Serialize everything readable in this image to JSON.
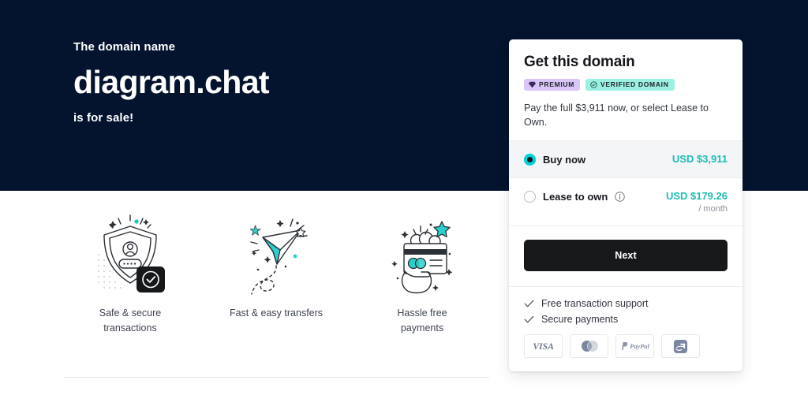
{
  "hero": {
    "kicker": "The domain name",
    "domain": "diagram.chat",
    "subtitle": "is for sale!",
    "background_color": "#05142e"
  },
  "features": [
    {
      "icon": "shield-lock-icon",
      "caption": "Safe & secure transactions"
    },
    {
      "icon": "paper-plane-icon",
      "caption": "Fast & easy transfers"
    },
    {
      "icon": "hand-credit-card-icon",
      "caption": "Hassle free payments"
    }
  ],
  "card": {
    "title": "Get this domain",
    "badges": [
      {
        "label": "PREMIUM",
        "icon": "gem-icon",
        "color": "#d9c6f7"
      },
      {
        "label": "VERIFIED DOMAIN",
        "icon": "check-circle-icon",
        "color": "#9cf0e2"
      }
    ],
    "note": "Pay the full $3,911 now, or select Lease to Own.",
    "options": [
      {
        "id": "buy-now",
        "label": "Buy now",
        "price": "USD $3,911",
        "per": "",
        "selected": true,
        "has_info_icon": false
      },
      {
        "id": "lease-to-own",
        "label": "Lease to own",
        "price": "USD $179.26",
        "per": "/ month",
        "selected": false,
        "has_info_icon": true
      }
    ],
    "cta_label": "Next",
    "perks": [
      "Free transaction support",
      "Secure payments"
    ],
    "payment_methods": [
      {
        "name": "visa",
        "label": "VISA"
      },
      {
        "name": "mastercard",
        "label": ""
      },
      {
        "name": "paypal",
        "label": "PayPal"
      },
      {
        "name": "alipay",
        "label": ""
      }
    ],
    "accent_color": "#1bbdb5",
    "radio_color": "#00d2d8"
  }
}
